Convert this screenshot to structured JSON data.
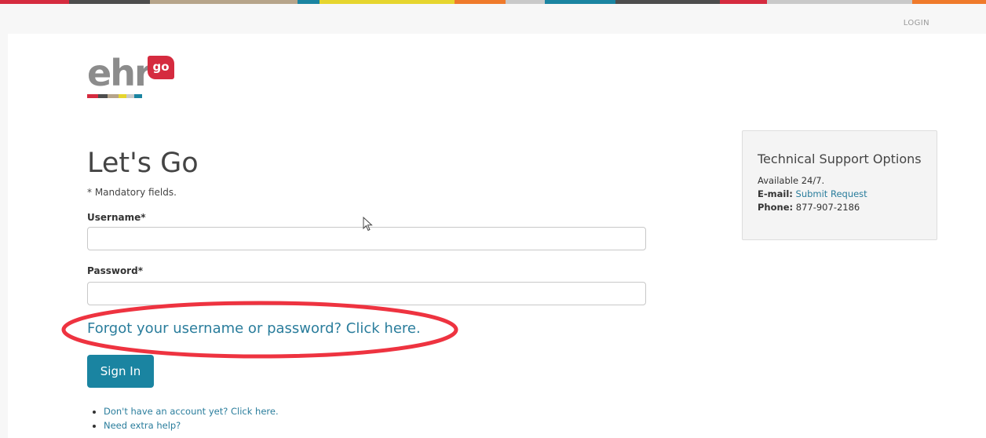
{
  "topnav": {
    "login_label": "LOGIN"
  },
  "logo": {
    "text": "ehr",
    "badge": "go"
  },
  "form": {
    "title": "Let's Go",
    "mandatory_note": "* Mandatory fields.",
    "username_label": "Username*",
    "username_value": "",
    "password_label": "Password*",
    "password_value": "",
    "forgot_link": "Forgot your username or password? Click here.",
    "signin_label": "Sign In"
  },
  "help_links": [
    "Don't have an account yet? Click here.",
    "Need extra help?"
  ],
  "support": {
    "title": "Technical Support Options",
    "availability": "Available 24/7.",
    "email_label": "E-mail:",
    "email_link": "Submit Request",
    "phone_label": "Phone:",
    "phone_value": "877-907-2186"
  },
  "colors": {
    "accent": "#1a84a1",
    "link": "#2a7d9c",
    "highlight": "#ee3340",
    "logo_red": "#d52b3f",
    "logo_gray": "#8c8c8c"
  },
  "icons": [
    "mouse-pointer-icon"
  ]
}
